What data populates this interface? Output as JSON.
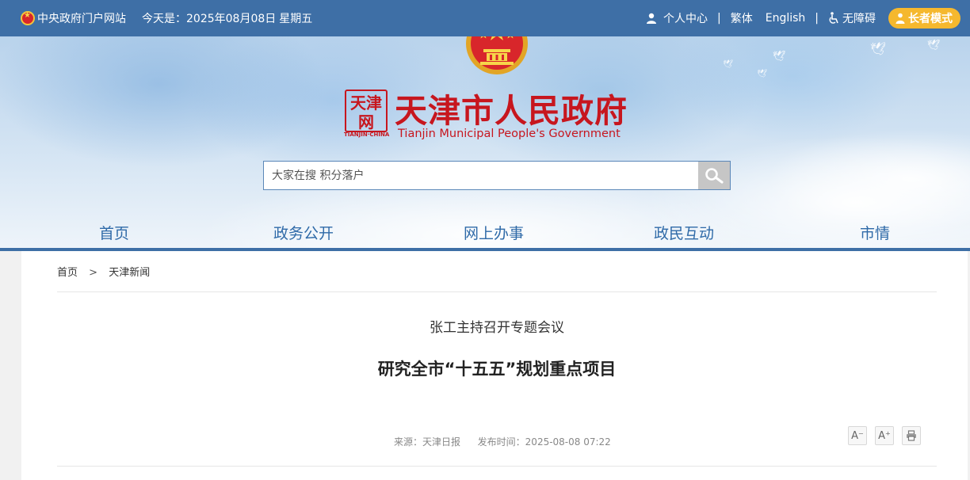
{
  "topbar": {
    "gov_portal": "中央政府门户网站",
    "today_label": "今天是：",
    "date": "2025年08月08日",
    "weekday": "星期五",
    "personal_center": "个人中心",
    "separator": "|",
    "traditional": "繁体",
    "english": "English",
    "accessibility": "无障碍",
    "elder_mode": "长者模式"
  },
  "header": {
    "site_title": "天津市人民政府",
    "site_subtitle": "Tianjin Municipal People's Government",
    "seal_text": "TIANJIN·CHINA"
  },
  "search": {
    "placeholder": "大家在搜 积分落户"
  },
  "nav": {
    "items": [
      {
        "label": "首页"
      },
      {
        "label": "政务公开"
      },
      {
        "label": "网上办事"
      },
      {
        "label": "政民互动"
      },
      {
        "label": "市情"
      }
    ]
  },
  "breadcrumb": {
    "home": "首页",
    "separator": ">",
    "current": "天津新闻"
  },
  "article": {
    "subtitle": "张工主持召开专题会议",
    "title": "研究全市“十五五”规划重点项目",
    "source_label": "来源：天津日报",
    "publish_time": "发布时间：2025-08-08 07:22"
  },
  "tools": {
    "font_decrease": "A⁻",
    "font_increase": "A⁺"
  },
  "colors": {
    "topbar_bg": "#3e6fa6",
    "brand_red": "#c7161e",
    "nav_text": "#2f6aa8",
    "elder_btn": "#f5b82e"
  }
}
